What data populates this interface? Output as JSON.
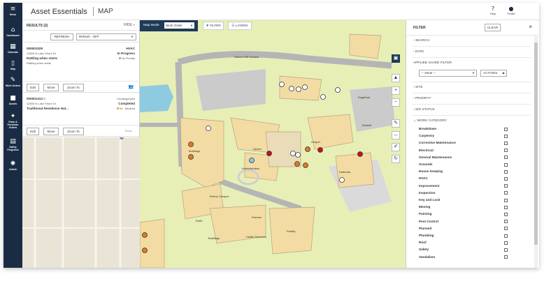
{
  "nav": {
    "items": [
      {
        "label": "Menu",
        "icon": "menu-icon",
        "glyph": "≡"
      },
      {
        "label": "Dashboard",
        "icon": "home-icon",
        "glyph": "⌂"
      },
      {
        "label": "Calendar",
        "icon": "calendar-icon",
        "glyph": "▦"
      },
      {
        "label": "Map",
        "icon": "map-icon",
        "glyph": "▯"
      },
      {
        "label": "Work Orders",
        "icon": "wrench-icon",
        "glyph": "✎"
      },
      {
        "label": "Assets",
        "icon": "briefcase-icon",
        "glyph": "■"
      },
      {
        "label": "Parts & Purchase Orders",
        "icon": "gear-icon",
        "glyph": "✦"
      },
      {
        "label": "Safety Programs",
        "icon": "clipboard-icon",
        "glyph": "▤"
      },
      {
        "label": "Admin",
        "icon": "admin-gear-icon",
        "glyph": "✺"
      }
    ]
  },
  "header": {
    "app_title": "Asset Essentials",
    "page_title": "MAP",
    "help_label": "Help",
    "profile_label": "Profile"
  },
  "results": {
    "title": "RESULTS (2)",
    "hide_label": "HIDE «",
    "refresh_label": "REFRESH",
    "refresh_select": "Refresh - OFF",
    "cards": [
      {
        "id": "000001029",
        "address": "12800 N Lake Shore Dr",
        "title": "Rattling when starts",
        "description": "Rattling when starts",
        "category": "HVAC",
        "status": "In Progress",
        "priority": "No Priority",
        "priority_color": "#9a9a9a",
        "actions": [
          "Edit",
          "Move",
          "Zoom To"
        ]
      },
      {
        "id": "000001413 ≡",
        "address": "12800 N Lake Shore Dr",
        "title": "Traditional Residence Hal...",
        "description": "",
        "category": "Uncategorized",
        "status": "Completed",
        "priority": "03 - Medium",
        "priority_color": "#f0a020",
        "actions": [
          "Edit",
          "Move",
          "Zoom To"
        ],
        "extra": "Show ..."
      }
    ]
  },
  "map": {
    "mode_label": "Map Mode",
    "mode_value": "Work Order",
    "filter_btn": "FILTER",
    "layers_btn": "LAYERS",
    "labels": [
      "Sacred Gift Outdoor",
      "Engelhart",
      "Chapel",
      "Ekstedt",
      "Kiprea",
      "Administration",
      "Buildings",
      "Kathedra",
      "Eberly Campus",
      "Science",
      "Buildings",
      "Earth",
      "Health Sciences",
      "Facility"
    ]
  },
  "filter": {
    "title": "FILTER",
    "clear_label": "CLEAR",
    "sections": [
      "SEARCH",
      "DATE"
    ],
    "saved_filter_label": "APPLIED SAVED FILTER",
    "saved_filter_value": "-- None --",
    "actions_label": "ACTIONS",
    "sections2": [
      "SITE",
      "PRIORITY",
      "WO STATUS",
      "WORK CATEGORY"
    ],
    "categories": [
      "Breakdown",
      "Carpentry",
      "Corrective Maintenance",
      "Electrical",
      "General Maintenance",
      "Grounds",
      "House Keeping",
      "HVAC",
      "Improvement",
      "Inspection",
      "Key and Lock",
      "Moving",
      "Painting",
      "Pest Control",
      "Planned",
      "Plumbing",
      "Roof",
      "Safety",
      "Vandalism"
    ]
  },
  "colors": {
    "nav_bg": "#1a2b44",
    "map_bg": "#e7efb7",
    "building": "#f3dca4",
    "pin_orange": "#e07a1f",
    "pin_red": "#c2121c",
    "pin_white": "#ffffff"
  }
}
